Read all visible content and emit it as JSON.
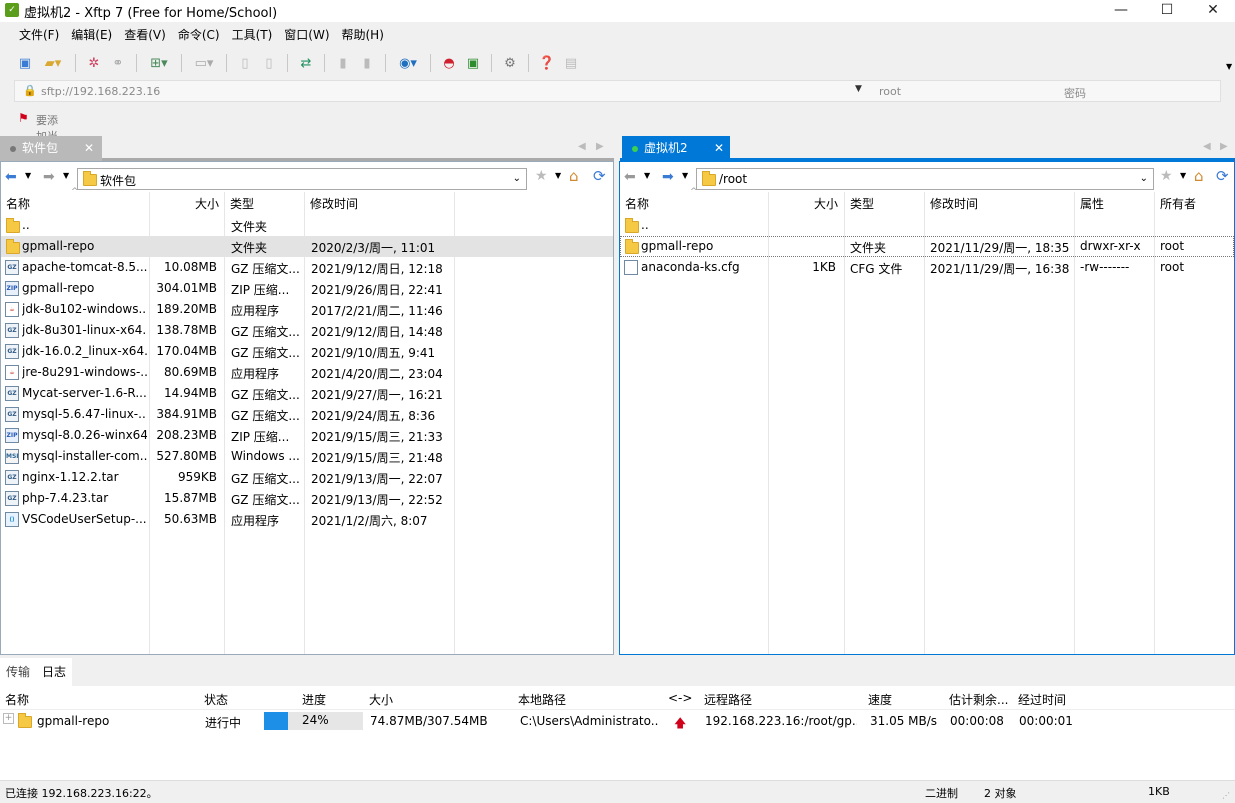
{
  "window": {
    "title": "虚拟机2 - Xftp 7 (Free for Home/School)",
    "minimize": "—",
    "maximize": "☐",
    "close": "✕"
  },
  "menu": [
    "文件(F)",
    "编辑(E)",
    "查看(V)",
    "命令(C)",
    "工具(T)",
    "窗口(W)",
    "帮助(H)"
  ],
  "address": {
    "url": "sftp://192.168.223.16",
    "username": "root",
    "password_placeholder": "密码"
  },
  "hint": "要添加当前会话，点击左侧的箭头按钮。",
  "left": {
    "tab_label": "软件包",
    "path": "软件包",
    "columns": [
      "名称",
      "大小",
      "类型",
      "修改时间"
    ],
    "rows": [
      {
        "name": "..",
        "size": "",
        "type": "文件夹",
        "mtime": "",
        "icon": "folder"
      },
      {
        "name": "gpmall-repo",
        "size": "",
        "type": "文件夹",
        "mtime": "2020/2/3/周一, 11:01",
        "icon": "folder"
      },
      {
        "name": "apache-tomcat-8.5....",
        "size": "10.08MB",
        "type": "GZ 压缩文...",
        "mtime": "2021/9/12/周日, 12:18",
        "icon": "gz"
      },
      {
        "name": "gpmall-repo",
        "size": "304.01MB",
        "type": "ZIP 压缩...",
        "mtime": "2021/9/26/周日, 22:41",
        "icon": "zip"
      },
      {
        "name": "jdk-8u102-windows...",
        "size": "189.20MB",
        "type": "应用程序",
        "mtime": "2017/2/21/周二, 11:46",
        "icon": "exe"
      },
      {
        "name": "jdk-8u301-linux-x64...",
        "size": "138.78MB",
        "type": "GZ 压缩文...",
        "mtime": "2021/9/12/周日, 14:48",
        "icon": "gz"
      },
      {
        "name": "jdk-16.0.2_linux-x64...",
        "size": "170.04MB",
        "type": "GZ 压缩文...",
        "mtime": "2021/9/10/周五, 9:41",
        "icon": "gz"
      },
      {
        "name": "jre-8u291-windows-...",
        "size": "80.69MB",
        "type": "应用程序",
        "mtime": "2021/4/20/周二, 23:04",
        "icon": "exe"
      },
      {
        "name": "Mycat-server-1.6-R...",
        "size": "14.94MB",
        "type": "GZ 压缩文...",
        "mtime": "2021/9/27/周一, 16:21",
        "icon": "gz"
      },
      {
        "name": "mysql-5.6.47-linux-...",
        "size": "384.91MB",
        "type": "GZ 压缩文...",
        "mtime": "2021/9/24/周五, 8:36",
        "icon": "gz"
      },
      {
        "name": "mysql-8.0.26-winx64",
        "size": "208.23MB",
        "type": "ZIP 压缩...",
        "mtime": "2021/9/15/周三, 21:33",
        "icon": "zip"
      },
      {
        "name": "mysql-installer-com...",
        "size": "527.80MB",
        "type": "Windows ...",
        "mtime": "2021/9/15/周三, 21:48",
        "icon": "msi"
      },
      {
        "name": "nginx-1.12.2.tar",
        "size": "959KB",
        "type": "GZ 压缩文...",
        "mtime": "2021/9/13/周一, 22:07",
        "icon": "gz"
      },
      {
        "name": "php-7.4.23.tar",
        "size": "15.87MB",
        "type": "GZ 压缩文...",
        "mtime": "2021/9/13/周一, 22:52",
        "icon": "gz"
      },
      {
        "name": "VSCodeUserSetup-...",
        "size": "50.63MB",
        "type": "应用程序",
        "mtime": "2021/1/2/周六, 8:07",
        "icon": "vscode"
      }
    ]
  },
  "right": {
    "tab_label": "虚拟机2",
    "path": "/root",
    "columns": [
      "名称",
      "大小",
      "类型",
      "修改时间",
      "属性",
      "所有者"
    ],
    "rows": [
      {
        "name": "..",
        "size": "",
        "type": "",
        "mtime": "",
        "attr": "",
        "owner": "",
        "icon": "folder"
      },
      {
        "name": "gpmall-repo",
        "size": "",
        "type": "文件夹",
        "mtime": "2021/11/29/周一, 18:35",
        "attr": "drwxr-xr-x",
        "owner": "root",
        "icon": "folder"
      },
      {
        "name": "anaconda-ks.cfg",
        "size": "1KB",
        "type": "CFG 文件",
        "mtime": "2021/11/29/周一, 16:38",
        "attr": "-rw-------",
        "owner": "root",
        "icon": "file"
      }
    ]
  },
  "lower_tabs": [
    "传输",
    "日志"
  ],
  "transfer": {
    "columns": [
      "名称",
      "状态",
      "进度",
      "大小",
      "本地路径",
      "<->",
      "远程路径",
      "速度",
      "估计剩余...",
      "经过时间"
    ],
    "row": {
      "name": "gpmall-repo",
      "status": "进行中",
      "progress": 0.24,
      "progress_text": "24%",
      "size": "74.87MB/307.54MB",
      "local": "C:\\Users\\Administrato...",
      "remote": "192.168.223.16:/root/gp...",
      "speed": "31.05 MB/s",
      "eta": "00:00:08",
      "elapsed": "00:00:01"
    }
  },
  "status": {
    "left": "已连接 192.168.223.16:22。",
    "mode": "二进制",
    "count": "2 对象",
    "size": "1KB"
  },
  "colors": {
    "accent": "#0078d7",
    "progress": "#1e8fe6",
    "upload_arrow": "#d0021b"
  }
}
